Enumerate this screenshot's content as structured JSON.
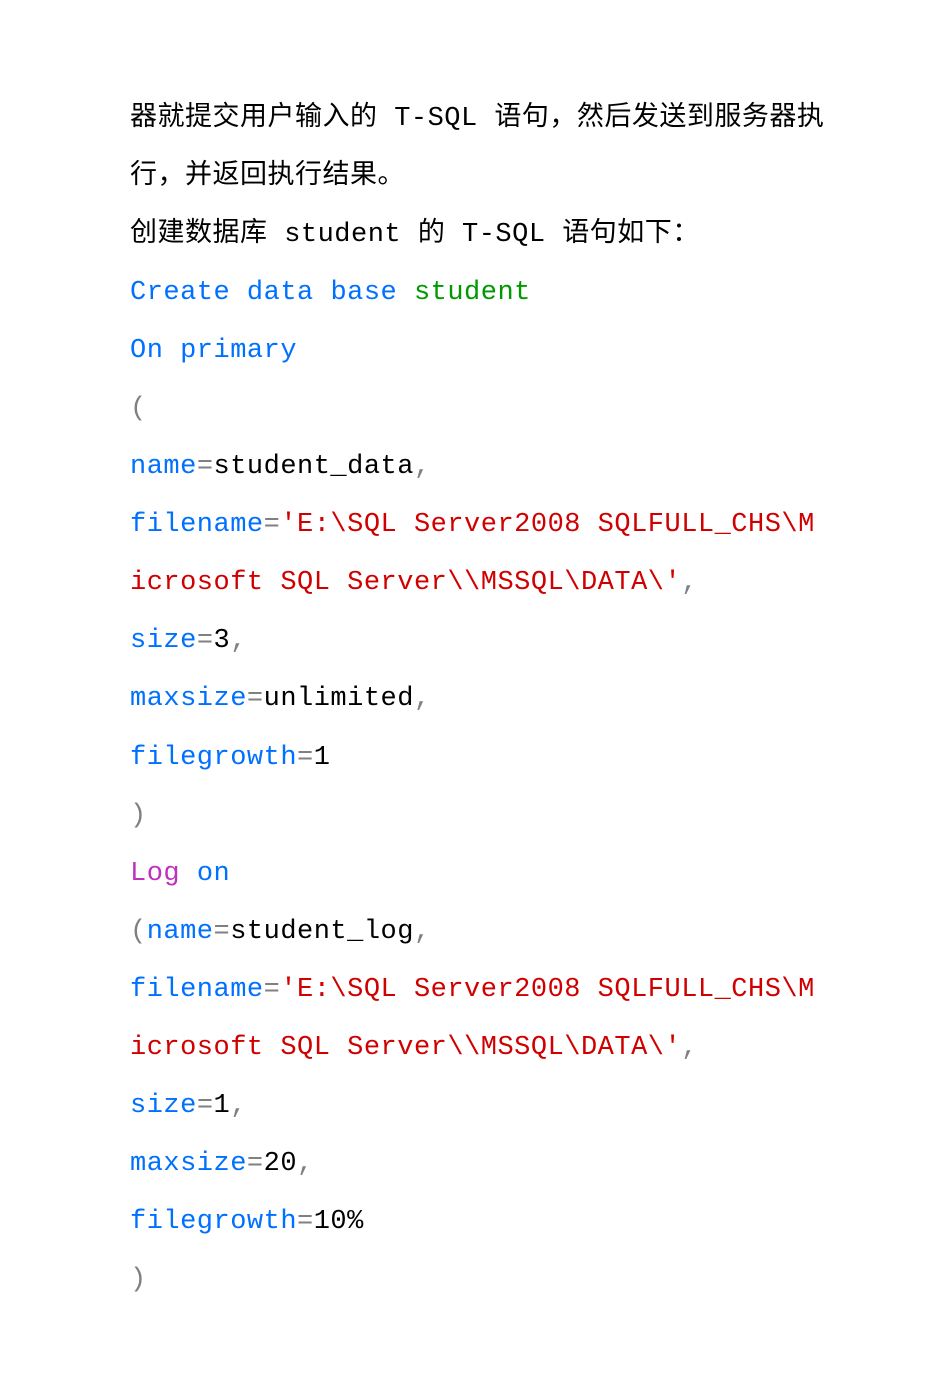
{
  "doc": {
    "lines": [
      {
        "segments": [
          {
            "text": "器就提交用户输入的 T-SQL 语句，然后发送到服务器执行，并返回执行结果。",
            "cls": "black"
          }
        ]
      },
      {
        "segments": [
          {
            "text": "创建数据库 student 的 T-SQL 语句如下：",
            "cls": "black"
          }
        ]
      },
      {
        "segments": [
          {
            "text": "Create",
            "cls": "blue"
          },
          {
            "text": " ",
            "cls": "black"
          },
          {
            "text": "data",
            "cls": "blue"
          },
          {
            "text": " ",
            "cls": "black"
          },
          {
            "text": "base",
            "cls": "blue"
          },
          {
            "text": " ",
            "cls": "black"
          },
          {
            "text": "student",
            "cls": "green"
          }
        ]
      },
      {
        "segments": [
          {
            "text": "On",
            "cls": "blue"
          },
          {
            "text": " ",
            "cls": "black"
          },
          {
            "text": "primary",
            "cls": "blue"
          }
        ]
      },
      {
        "segments": [
          {
            "text": "(",
            "cls": "gray"
          }
        ]
      },
      {
        "segments": [
          {
            "text": "name",
            "cls": "blue"
          },
          {
            "text": "=",
            "cls": "gray"
          },
          {
            "text": "student_data",
            "cls": "black"
          },
          {
            "text": ",",
            "cls": "gray"
          }
        ]
      },
      {
        "segments": [
          {
            "text": "filename",
            "cls": "blue"
          },
          {
            "text": "=",
            "cls": "gray"
          },
          {
            "text": "'E:\\SQL Server2008 SQLFULL_CHS\\Microsoft SQL Server\\\\MSSQL\\DATA\\'",
            "cls": "red"
          },
          {
            "text": ",",
            "cls": "gray"
          }
        ]
      },
      {
        "segments": [
          {
            "text": "size",
            "cls": "blue"
          },
          {
            "text": "=",
            "cls": "gray"
          },
          {
            "text": "3",
            "cls": "black"
          },
          {
            "text": ",",
            "cls": "gray"
          }
        ]
      },
      {
        "segments": [
          {
            "text": "maxsize",
            "cls": "blue"
          },
          {
            "text": "=",
            "cls": "gray"
          },
          {
            "text": "unlimited",
            "cls": "black"
          },
          {
            "text": ",",
            "cls": "gray"
          }
        ]
      },
      {
        "segments": [
          {
            "text": "filegrowth",
            "cls": "blue"
          },
          {
            "text": "=",
            "cls": "gray"
          },
          {
            "text": "1",
            "cls": "black"
          }
        ]
      },
      {
        "segments": [
          {
            "text": ")",
            "cls": "gray"
          }
        ]
      },
      {
        "segments": [
          {
            "text": "Log",
            "cls": "magenta"
          },
          {
            "text": " ",
            "cls": "black"
          },
          {
            "text": "on",
            "cls": "blue"
          }
        ]
      },
      {
        "segments": [
          {
            "text": "(",
            "cls": "gray"
          },
          {
            "text": "name",
            "cls": "blue"
          },
          {
            "text": "=",
            "cls": "gray"
          },
          {
            "text": "student_log",
            "cls": "black"
          },
          {
            "text": ",",
            "cls": "gray"
          }
        ]
      },
      {
        "segments": [
          {
            "text": "filename",
            "cls": "blue"
          },
          {
            "text": "=",
            "cls": "gray"
          },
          {
            "text": "'E:\\SQL Server2008 SQLFULL_CHS\\Microsoft SQL Server\\\\MSSQL\\DATA\\'",
            "cls": "red"
          },
          {
            "text": ",",
            "cls": "gray"
          }
        ]
      },
      {
        "segments": [
          {
            "text": "size",
            "cls": "blue"
          },
          {
            "text": "=",
            "cls": "gray"
          },
          {
            "text": "1",
            "cls": "black"
          },
          {
            "text": ",",
            "cls": "gray"
          }
        ]
      },
      {
        "segments": [
          {
            "text": "maxsize",
            "cls": "blue"
          },
          {
            "text": "=",
            "cls": "gray"
          },
          {
            "text": "20",
            "cls": "black"
          },
          {
            "text": ",",
            "cls": "gray"
          }
        ]
      },
      {
        "segments": [
          {
            "text": "filegrowth",
            "cls": "blue"
          },
          {
            "text": "=",
            "cls": "gray"
          },
          {
            "text": "10%",
            "cls": "black"
          }
        ]
      },
      {
        "segments": [
          {
            "text": ")",
            "cls": "gray"
          }
        ]
      }
    ]
  }
}
